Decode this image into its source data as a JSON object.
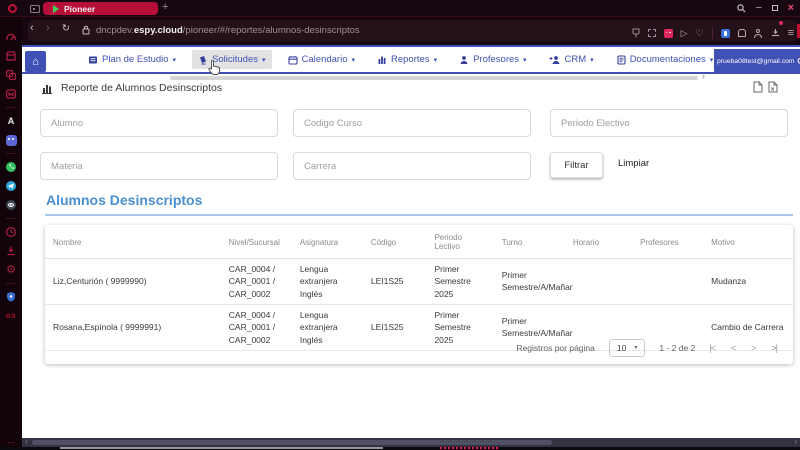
{
  "glyphs": {
    "back": "‹",
    "forward": "›",
    "reload": "↻",
    "new_tab": "+",
    "minimize": "–",
    "close": "×",
    "play_outline": "▷",
    "heart": "♡",
    "menu": "≡",
    "caret": "▾",
    "home": "⌂",
    "gear": "⚙",
    "dots": "⋯",
    "gx": "GX",
    "aria": "A",
    "nav_more": "›",
    "scroll_left": "‹",
    "scroll_right": "›"
  },
  "browser": {
    "tab_title": "Pioneer",
    "url_pre": "dncpdev.",
    "url_host": "espy.cloud",
    "url_path": "/pioneer/#/reportes/alumnos-desinscriptos"
  },
  "navbar": {
    "items": [
      "Plan de Estudio",
      "Solicitudes",
      "Calendario",
      "Reportes",
      "Profesores",
      "CRM",
      "Documentaciones"
    ],
    "user_email": "prueba08test@gmail.com"
  },
  "report": {
    "title": "Reporte de Alumnos Desinscriptos",
    "filters": [
      "Alumno",
      "Codigo Curso",
      "Periodo Electivo",
      "Materia",
      "Carrera"
    ],
    "filtrar": "Filtrar",
    "limpiar": "Limpiar",
    "section_title": "Alumnos Desinscriptos"
  },
  "table": {
    "columns": [
      "Nombre",
      "Nivel/Sucursal",
      "Asignatura",
      "Código",
      "Periodo Lectivo",
      "Turno",
      "Horario",
      "Profesores",
      "Motivo"
    ],
    "rows": [
      [
        "Liz,Centurión ( 9999990)",
        "CAR_0004 / CAR_0001 / CAR_0002",
        "Lengua extranjera Inglés",
        "LEI1S25",
        "Primer Semestre 2025",
        "Primer Semestre/A/Mañar",
        "",
        "",
        "Mudanza"
      ],
      [
        "Rosana,Espínola ( 9999991)",
        "CAR_0004 / CAR_0001 / CAR_0002",
        "Lengua extranjera Inglés",
        "LEI1S25",
        "Primer Semestre 2025",
        "Primer Semestre/A/Mañar",
        "",
        "",
        "Cambio de Carrera"
      ]
    ]
  },
  "pagination": {
    "label": "Registros por página",
    "per_page": "10",
    "range": "1 - 2 de 2",
    "first": "|<",
    "prev": "<",
    "next": ">",
    "last": ">|"
  },
  "colors": {
    "accent": "#3f51b5",
    "tab": "#b50f3a",
    "section_title": "#4a90d2"
  }
}
